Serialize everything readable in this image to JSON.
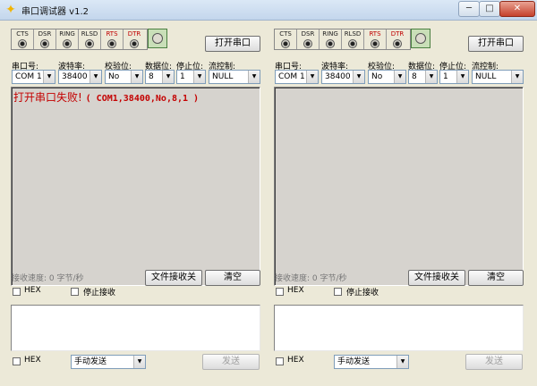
{
  "window": {
    "title": "串口调试器 v1.2",
    "minimize": "─",
    "maximize": "□",
    "close": "✕"
  },
  "panels": [
    {
      "leds": [
        "CTS",
        "DSR",
        "RING",
        "RLSD",
        "RTS",
        "DTR"
      ],
      "open_button": "打开串口",
      "labels": {
        "port": "串口号:",
        "baud": "波特率:",
        "parity": "校验位:",
        "databits": "数据位:",
        "stopbits": "停止位:",
        "flow": "流控制:"
      },
      "values": {
        "port": "COM 1",
        "baud": "38400",
        "parity": "No",
        "databits": "8",
        "stopbits": "1",
        "flow": "NULL"
      },
      "receive_cn": "打开串口失败! ",
      "receive_mono": "( COM1,38400,No,8,1 )",
      "speed": "接收速度: 0 字节/秒",
      "file_button": "文件接收关",
      "clear_button": "清空",
      "hex_label": "HEX",
      "stop_label": "停止接收",
      "send_hex_label": "HEX",
      "send_mode": "手动发送",
      "send_button": "发送"
    },
    {
      "leds": [
        "CTS",
        "DSR",
        "RING",
        "RLSD",
        "RTS",
        "DTR"
      ],
      "open_button": "打开串口",
      "labels": {
        "port": "串口号:",
        "baud": "波特率:",
        "parity": "校验位:",
        "databits": "数据位:",
        "stopbits": "停止位:",
        "flow": "流控制:"
      },
      "values": {
        "port": "COM 1",
        "baud": "38400",
        "parity": "No",
        "databits": "8",
        "stopbits": "1",
        "flow": "NULL"
      },
      "receive_cn": "",
      "receive_mono": "",
      "speed": "接收速度: 0 字节/秒",
      "file_button": "文件接收关",
      "clear_button": "清空",
      "hex_label": "HEX",
      "stop_label": "停止接收",
      "send_hex_label": "HEX",
      "send_mode": "手动发送",
      "send_button": "发送"
    }
  ],
  "colors": {
    "error_text": "#c40000",
    "led_red_label": "#c00000"
  }
}
